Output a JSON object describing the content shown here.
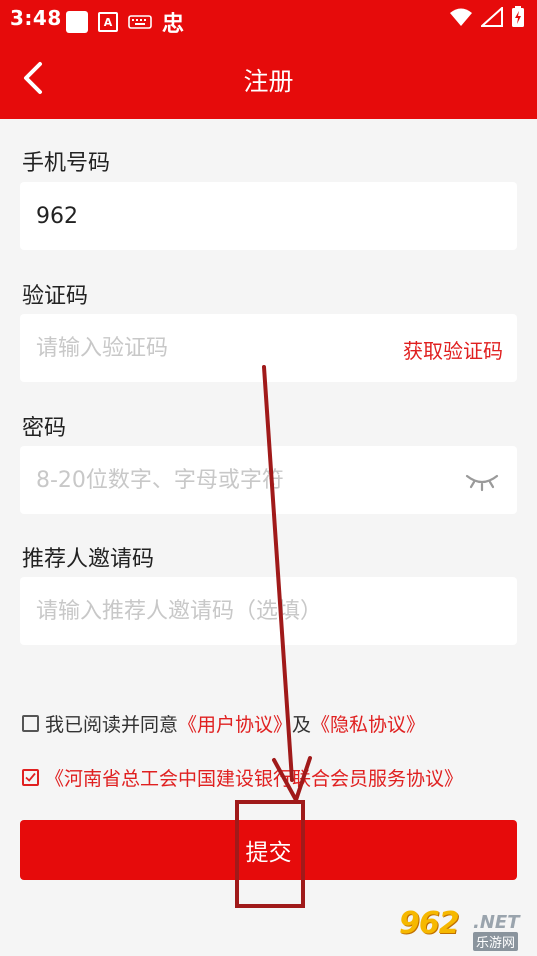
{
  "status_bar": {
    "time": "3:48",
    "bug_glyph": "忠",
    "keyboard_letter": "A"
  },
  "nav": {
    "title": "注册"
  },
  "phone": {
    "label": "手机号码",
    "value": "962"
  },
  "code": {
    "label": "验证码",
    "placeholder": "请输入验证码",
    "get_code": "获取验证码"
  },
  "password": {
    "label": "密码",
    "placeholder": "8-20位数字、字母或字符"
  },
  "referrer": {
    "label": "推荐人邀请码",
    "placeholder": "请输入推荐人邀请码（选填）"
  },
  "agreement1": {
    "checked": false,
    "prefix": "我已阅读并同意",
    "link1": "《用户协议》",
    "middle": "及",
    "link2": "《隐私协议》"
  },
  "agreement2": {
    "checked": true,
    "link": "《河南省总工会中国建设银行联合会员服务协议》"
  },
  "submit": {
    "label": "提交"
  },
  "watermark": {
    "digits": "962",
    "net": ".NET",
    "cn": "乐游网"
  },
  "colors": {
    "brand_red": "#e60b0b",
    "link_red": "#e02020",
    "annotation_red": "#a01a1a",
    "background": "#f5f5f5"
  },
  "icons": {
    "back": "chevron-left-icon",
    "eye": "eye-closed-icon",
    "wifi": "wifi-icon",
    "signal": "signal-icon",
    "battery": "battery-charging-icon"
  }
}
